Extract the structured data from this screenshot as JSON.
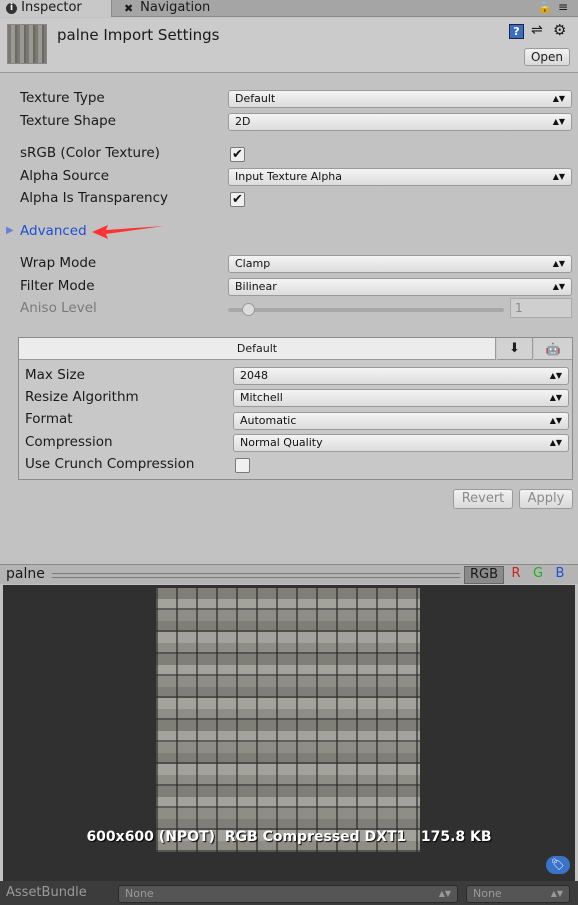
{
  "tabs": {
    "inspector": "Inspector",
    "navigation": "Navigation"
  },
  "header": {
    "title": "palne Import Settings",
    "open_button": "Open"
  },
  "fields": {
    "texture_type": {
      "label": "Texture Type",
      "value": "Default"
    },
    "texture_shape": {
      "label": "Texture Shape",
      "value": "2D"
    },
    "srgb": {
      "label": "sRGB (Color Texture)",
      "checked": true
    },
    "alpha_source": {
      "label": "Alpha Source",
      "value": "Input Texture Alpha"
    },
    "alpha_transparency": {
      "label": "Alpha Is Transparency",
      "checked": true
    },
    "advanced": "Advanced",
    "wrap_mode": {
      "label": "Wrap Mode",
      "value": "Clamp"
    },
    "filter_mode": {
      "label": "Filter Mode",
      "value": "Bilinear"
    },
    "aniso_level": {
      "label": "Aniso Level",
      "value": "1",
      "slider_fraction": 0.0
    }
  },
  "platform": {
    "tab_default": "Default",
    "max_size": {
      "label": "Max Size",
      "value": "2048"
    },
    "resize_algorithm": {
      "label": "Resize Algorithm",
      "value": "Mitchell"
    },
    "format": {
      "label": "Format",
      "value": "Automatic"
    },
    "compression": {
      "label": "Compression",
      "value": "Normal Quality"
    },
    "crunch": {
      "label": "Use Crunch Compression",
      "checked": false
    }
  },
  "actions": {
    "revert": "Revert",
    "apply": "Apply"
  },
  "preview": {
    "title": "palne",
    "channels": {
      "rgb": "RGB",
      "r": "R",
      "g": "G",
      "b": "B"
    },
    "info": "600x600 (NPOT)  RGB Compressed DXT1   175.8 KB"
  },
  "assetbundle": {
    "label": "AssetBundle",
    "name": "None",
    "variant": "None"
  },
  "colors": {
    "advanced_link": "#1f4fd1",
    "arrow": "#ff3333",
    "channel_r": "#d02020",
    "channel_g": "#20b020",
    "channel_b": "#2050e0"
  }
}
